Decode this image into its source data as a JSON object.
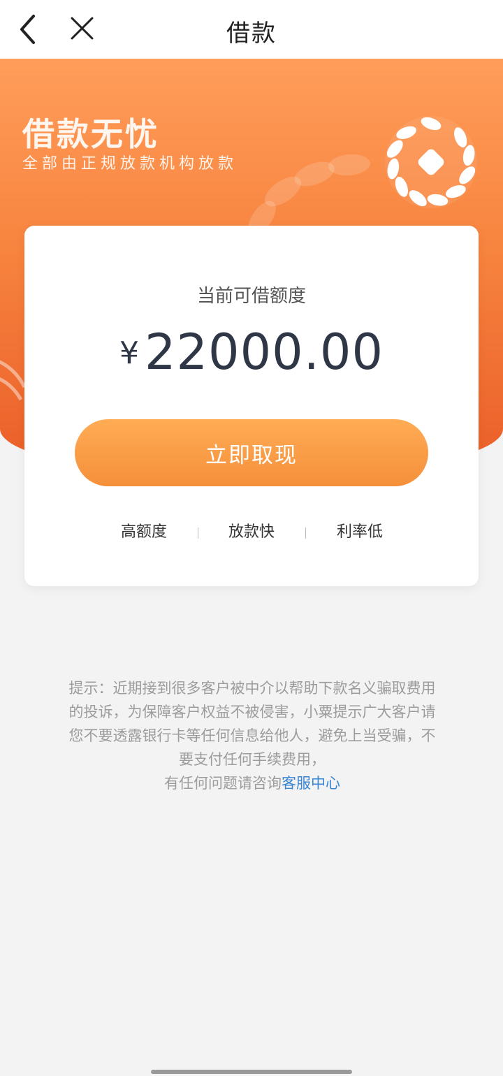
{
  "nav": {
    "title": "借款",
    "back_icon": "chevron-left-icon",
    "close_icon": "close-icon"
  },
  "banner": {
    "slogan": "借款无忧",
    "subtitle": "全部由正规放款机构放款",
    "emblem_icon": "coin-wreath-icon",
    "colors": {
      "top": "#ff9d5a",
      "bottom": "#ea5d28"
    }
  },
  "card": {
    "label": "当前可借额度",
    "currency": "¥",
    "amount": "22000.00",
    "cta_label": "立即取现",
    "features": [
      "高额度",
      "放款快",
      "利率低"
    ],
    "cta_colors": {
      "top": "#ffac55",
      "bottom": "#f58f3a"
    }
  },
  "notice": {
    "lines": [
      "提示：近期接到很多客户被中介以帮助下款名义骗取费用",
      "的投诉，为保障客户权益不被侵害，小粟提示广大客户请",
      "您不要透露银行卡等任何信息给他人，避免上当受骗，不",
      "要支付任何手续费用，"
    ],
    "last_prefix": "有任何问题请咨询",
    "link_text": "客服中心",
    "link_color": "#3a86d4"
  }
}
